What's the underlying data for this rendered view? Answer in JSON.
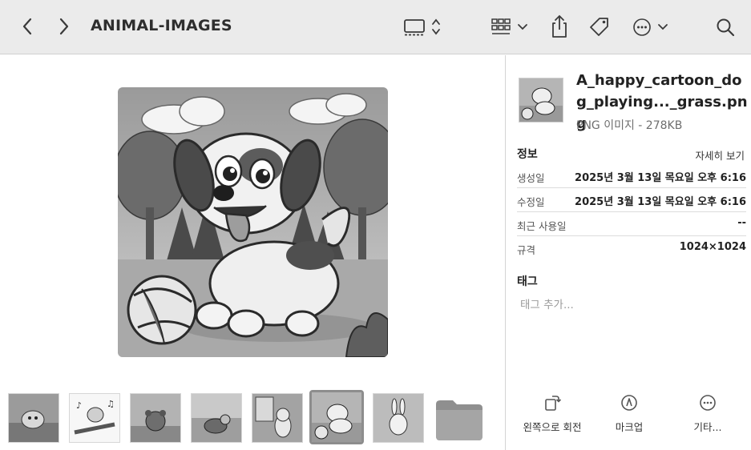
{
  "toolbar": {
    "folder_title": "ANIMAL-IMAGES",
    "icons": [
      "chevron-left-icon",
      "chevron-right-icon",
      "gallery-view-icon",
      "group-grid-icon",
      "share-icon",
      "tag-icon",
      "more-ellipsis-icon",
      "search-icon"
    ]
  },
  "preview": {
    "file": "A_happy_cartoon_dog_playing..._grass.png"
  },
  "strip": {
    "thumbnails": [
      {
        "subject": "cat in garden"
      },
      {
        "subject": "bird on branch with music notes"
      },
      {
        "subject": "bear cub near palms"
      },
      {
        "subject": "turtle on beach"
      },
      {
        "subject": "cat in garden window"
      },
      {
        "subject": "dog playing with ball",
        "selected": true
      },
      {
        "subject": "bunny in garden"
      },
      {
        "subject": "folder"
      }
    ]
  },
  "inspector": {
    "file_name": "A_happy_cartoon_dog_playing..._grass.png",
    "file_kind": "PNG 이미지 - 278KB",
    "info_heading": "정보",
    "show_more": "자세히 보기",
    "rows": [
      {
        "key": "생성일",
        "value": "2025년 3월 13일 목요일 오후 6:16"
      },
      {
        "key": "수정일",
        "value": "2025년 3월 13일 목요일 오후 6:16"
      },
      {
        "key": "최근 사용일",
        "value": "--"
      },
      {
        "key": "규격",
        "value": "1024×1024"
      }
    ],
    "tags_heading": "태그",
    "tags_placeholder": "태그 추가...",
    "actions": [
      {
        "label": "왼쪽으로 회전",
        "icon": "rotate-left-icon"
      },
      {
        "label": "마크업",
        "icon": "markup-icon"
      },
      {
        "label": "기타...",
        "icon": "more-ellipsis-icon"
      }
    ]
  },
  "colors": {
    "toolbar_bg": "#ebebeb",
    "divider": "#d4d4d4",
    "text_primary": "#222222",
    "text_secondary": "#6e6e6e"
  }
}
